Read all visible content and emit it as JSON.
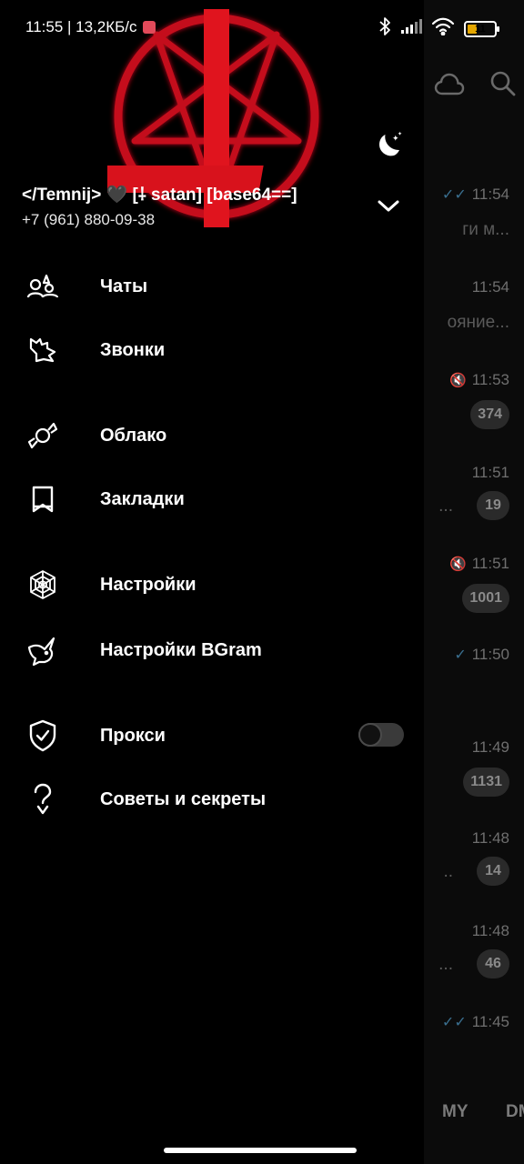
{
  "status_bar": {
    "time_speed": "11:55 | 13,2КБ/с",
    "battery": "11"
  },
  "drawer": {
    "user_name": "</Temnij> 🖤 [⸸ satan] [base64==]",
    "phone": "+7 (961) 880-09-38",
    "header_icons": [
      "heart-icon",
      "cloud-icon",
      "search-icon",
      "moon-icon",
      "chevron-down-icon"
    ],
    "menu": [
      {
        "label": "Чаты",
        "icon": "chats-icon"
      },
      {
        "label": "Звонки",
        "icon": "calls-icon"
      },
      {
        "label": "Облако",
        "icon": "cloud-candy-icon"
      },
      {
        "label": "Закладки",
        "icon": "bookmark-icon"
      },
      {
        "label": "Настройки",
        "icon": "spider-web-icon"
      },
      {
        "label": "Настройки BGram",
        "icon": "bird-icon"
      },
      {
        "label": "Прокси",
        "icon": "shield-icon"
      },
      {
        "label": "Советы и секреты",
        "icon": "question-icon"
      }
    ],
    "proxy_enabled": false
  },
  "chats": [
    {
      "time": "11:54",
      "preview": "ги м...",
      "status": "read"
    },
    {
      "time": "11:54",
      "preview": "ояние..."
    },
    {
      "time": "11:53",
      "badge": "374",
      "muted": true
    },
    {
      "time": "11:51",
      "preview": "...",
      "badge": "19"
    },
    {
      "time": "11:51",
      "badge": "1001",
      "muted": true
    },
    {
      "time": "11:50",
      "status": "sent"
    },
    {
      "time": "11:49",
      "badge": "1131"
    },
    {
      "time": "11:48",
      "preview": "..",
      "badge": "14"
    },
    {
      "time": "11:48",
      "preview": "...",
      "badge": "46"
    },
    {
      "time": "11:45",
      "status": "read"
    }
  ],
  "bottom_tabs": [
    "MY",
    "DM"
  ],
  "colors": {
    "accent_red": "#e0141e",
    "background": "#000000"
  }
}
